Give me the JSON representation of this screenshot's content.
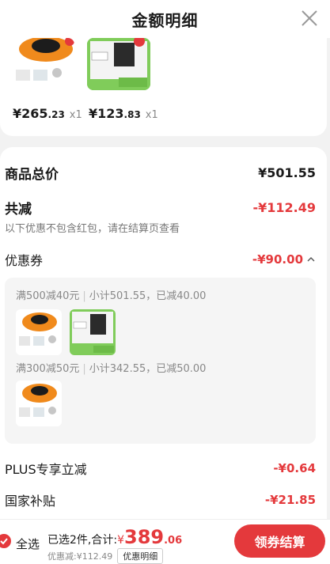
{
  "header": {
    "title": "金额明细"
  },
  "products": [
    {
      "price_int": "¥265",
      "price_dec": ".23",
      "qty": "x1"
    },
    {
      "price_int": "¥123",
      "price_dec": ".83",
      "qty": "x1"
    }
  ],
  "summary": {
    "total_label": "商品总价",
    "total_value": "¥501.55",
    "discount_label": "共减",
    "discount_value": "-¥112.49",
    "note": "以下优惠不包含红包，请在结算页查看",
    "coupon_label": "优惠券",
    "coupon_value": "-¥90.00",
    "plus_label": "PLUS专享立减",
    "plus_value": "-¥0.64",
    "subsidy_label": "国家补贴",
    "subsidy_value": "-¥21.85"
  },
  "coupons": [
    {
      "rule": "满500减40元",
      "detail": "小计501.55，已减40.00"
    },
    {
      "rule": "满300减50元",
      "detail": "小计342.55，已减50.00"
    }
  ],
  "bottom": {
    "select_all": "全选",
    "selected_text": "已选2件,合计:",
    "currency": "¥",
    "amount_int": "389",
    "amount_dec": ".06",
    "saved_text": "优惠减:¥112.49",
    "detail_button": "优惠明细",
    "checkout_button": "领券结算"
  },
  "colors": {
    "accent": "#e4393c"
  }
}
